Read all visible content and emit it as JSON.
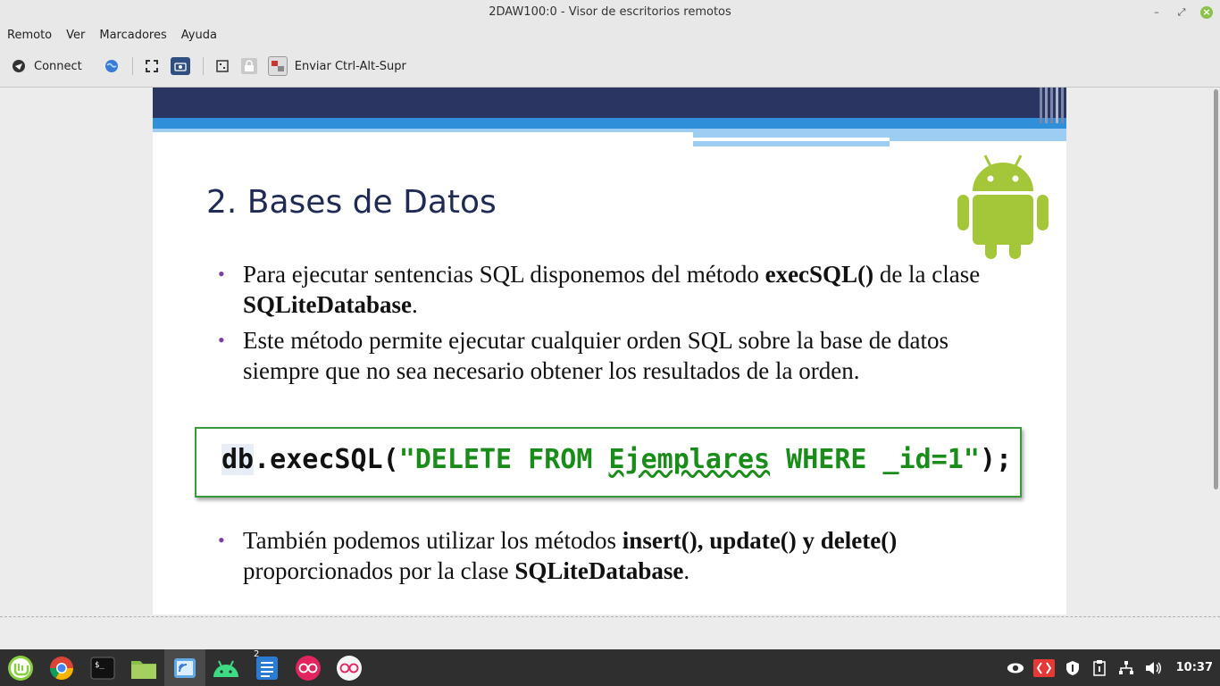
{
  "window": {
    "title": "2DAW100:0 - Visor de escritorios remotos"
  },
  "menu": {
    "items": [
      "Remoto",
      "Ver",
      "Marcadores",
      "Ayuda"
    ]
  },
  "toolbar": {
    "connect_label": "Connect",
    "send_keys_label": "Enviar Ctrl-Alt-Supr"
  },
  "slide": {
    "title": "2. Bases de Datos",
    "bullet1": {
      "t1": "Para ejecutar sentencias SQL disponemos del método ",
      "b1": "execSQL()",
      "t2": " de la clase ",
      "b2": "SQLiteDatabase",
      "t3": "."
    },
    "bullet2": {
      "text": "Este método permite ejecutar cualquier orden SQL sobre la base de datos siempre que no sea necesario obtener los resultados de la orden."
    },
    "code": {
      "obj": "db",
      "p1": ".execSQL(",
      "s1": "\"DELETE FROM ",
      "s2": "Ejemplares",
      "s3": " WHERE _id=1\"",
      "p2": ");"
    },
    "bullet3": {
      "t1": "También podemos utilizar los métodos ",
      "b1": "insert(), update() y delete()",
      "t2": " proporcionados por la clase ",
      "b2": "SQLiteDatabase",
      "t3": "."
    }
  },
  "taskbar": {
    "clock": "10:37",
    "workspace_badge": "2"
  },
  "colors": {
    "accent_navy": "#2b3561",
    "accent_blue": "#2f8fd8",
    "android_green": "#a4c639",
    "code_green": "#1a8c1a"
  }
}
